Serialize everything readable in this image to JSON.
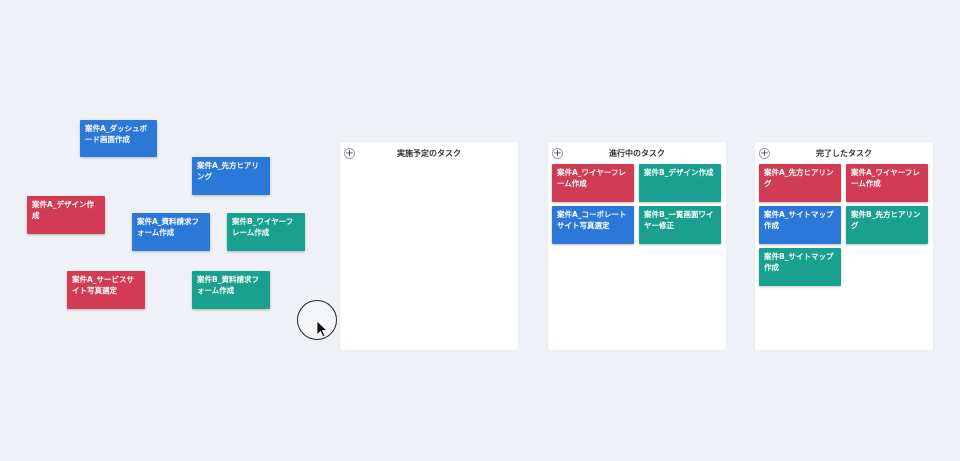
{
  "floating_cards": [
    {
      "text": "案件A_ダッシュボード画面作成",
      "color": "blue"
    },
    {
      "text": "案件A_先方ヒアリング",
      "color": "blue"
    },
    {
      "text": "案件A_デザイン作成",
      "color": "red"
    },
    {
      "text": "案件A_資料請求フォーム作成",
      "color": "blue"
    },
    {
      "text": "案件B_ワイヤーフレーム作成",
      "color": "green"
    },
    {
      "text": "案件A_サービスサイト写真選定",
      "color": "red"
    },
    {
      "text": "案件B_資料請求フォーム作成",
      "color": "green"
    }
  ],
  "columns": [
    {
      "title": "実施予定のタスク",
      "add_label": "+",
      "cards": []
    },
    {
      "title": "進行中のタスク",
      "add_label": "+",
      "cards": [
        {
          "text": "案件A_ワイヤーフレーム作成",
          "color": "red"
        },
        {
          "text": "案件B_デザイン作成",
          "color": "green"
        },
        {
          "text": "案件A_コーポレートサイト写真選定",
          "color": "blue"
        },
        {
          "text": "案件B_一覧画面ワイヤー修正",
          "color": "green"
        }
      ]
    },
    {
      "title": "完了したタスク",
      "add_label": "+",
      "cards": [
        {
          "text": "案件A_先方ヒアリング",
          "color": "red"
        },
        {
          "text": "案件A_ワイヤーフレーム作成",
          "color": "red"
        },
        {
          "text": "案件A_サイトマップ作成",
          "color": "blue"
        },
        {
          "text": "案件B_先方ヒアリング",
          "color": "green"
        },
        {
          "text": "案件B_サイトマップ作成",
          "color": "green"
        }
      ]
    }
  ],
  "colors": {
    "red": "#d13c54",
    "blue": "#2b78d8",
    "green": "#1aa08f",
    "background": "#eef1f5"
  },
  "icons": {
    "add": "plus-icon",
    "cursor": "pointer-arrow-icon"
  }
}
